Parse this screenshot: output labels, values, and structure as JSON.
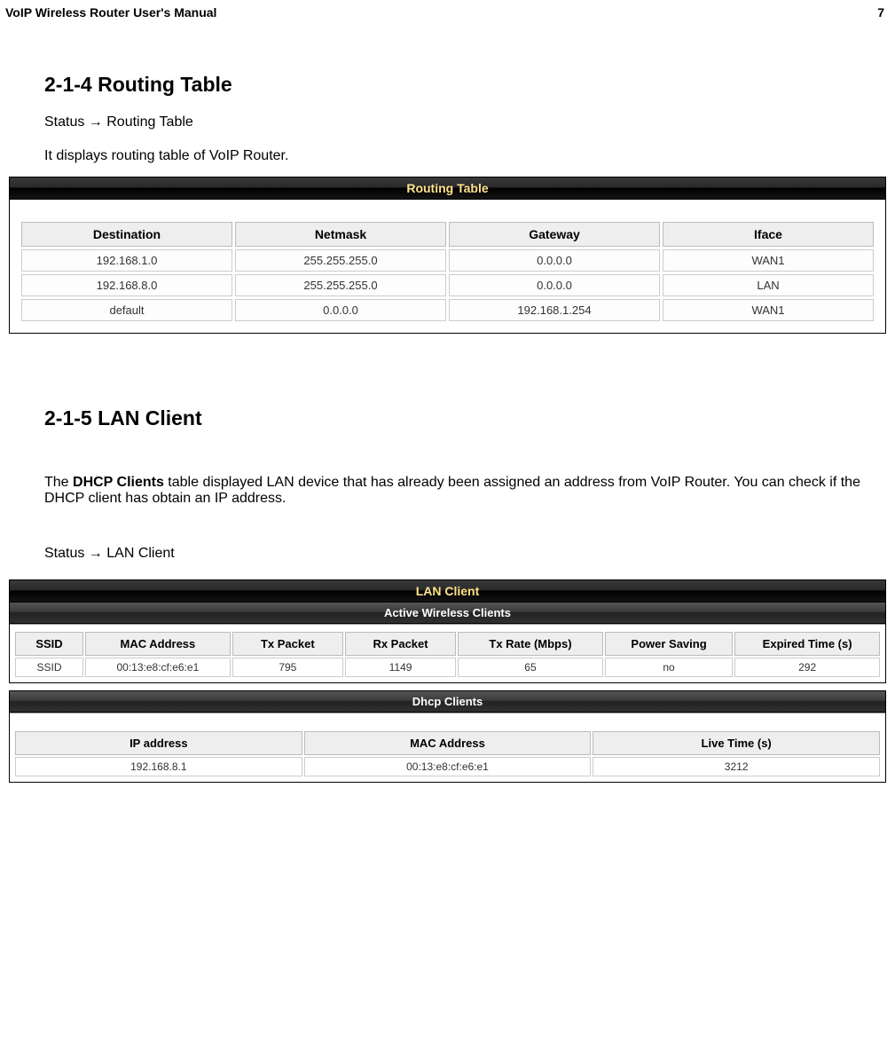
{
  "header": {
    "title": "VoIP Wireless Router User's Manual",
    "page_number": "7"
  },
  "section1": {
    "heading": "2-1-4 Routing Table",
    "breadcrumb_a": "Status",
    "breadcrumb_arrow": " → ",
    "breadcrumb_b": "  Routing Table",
    "desc": "It displays routing table of VoIP Router."
  },
  "routing_panel": {
    "title": "Routing Table",
    "columns": [
      "Destination",
      "Netmask",
      "Gateway",
      "Iface"
    ],
    "rows": [
      [
        "192.168.1.0",
        "255.255.255.0",
        "0.0.0.0",
        "WAN1"
      ],
      [
        "192.168.8.0",
        "255.255.255.0",
        "0.0.0.0",
        "LAN"
      ],
      [
        "default",
        "0.0.0.0",
        "192.168.1.254",
        "WAN1"
      ]
    ]
  },
  "section2": {
    "heading": "2-1-5 LAN Client",
    "desc_prefix": "The ",
    "desc_bold": "DHCP Clients",
    "desc_suffix": " table displayed LAN device that has already been assigned an address from VoIP Router. You can check if the DHCP client has obtain an IP address.",
    "breadcrumb_a": "Status",
    "breadcrumb_arrow": " → ",
    "breadcrumb_b": "  LAN Client"
  },
  "lan_panel": {
    "title": "LAN Client",
    "wireless": {
      "subtitle": "Active Wireless Clients",
      "columns": [
        "SSID",
        "MAC Address",
        "Tx Packet",
        "Rx Packet",
        "Tx Rate (Mbps)",
        "Power Saving",
        "Expired Time (s)"
      ],
      "rows": [
        [
          "SSID",
          "00:13:e8:cf:e6:e1",
          "795",
          "1149",
          "65",
          "no",
          "292"
        ]
      ]
    },
    "dhcp": {
      "subtitle": "Dhcp Clients",
      "columns": [
        "IP address",
        "MAC Address",
        "Live Time (s)"
      ],
      "rows": [
        [
          "192.168.8.1",
          "00:13:e8:cf:e6:e1",
          "3212"
        ]
      ]
    }
  }
}
